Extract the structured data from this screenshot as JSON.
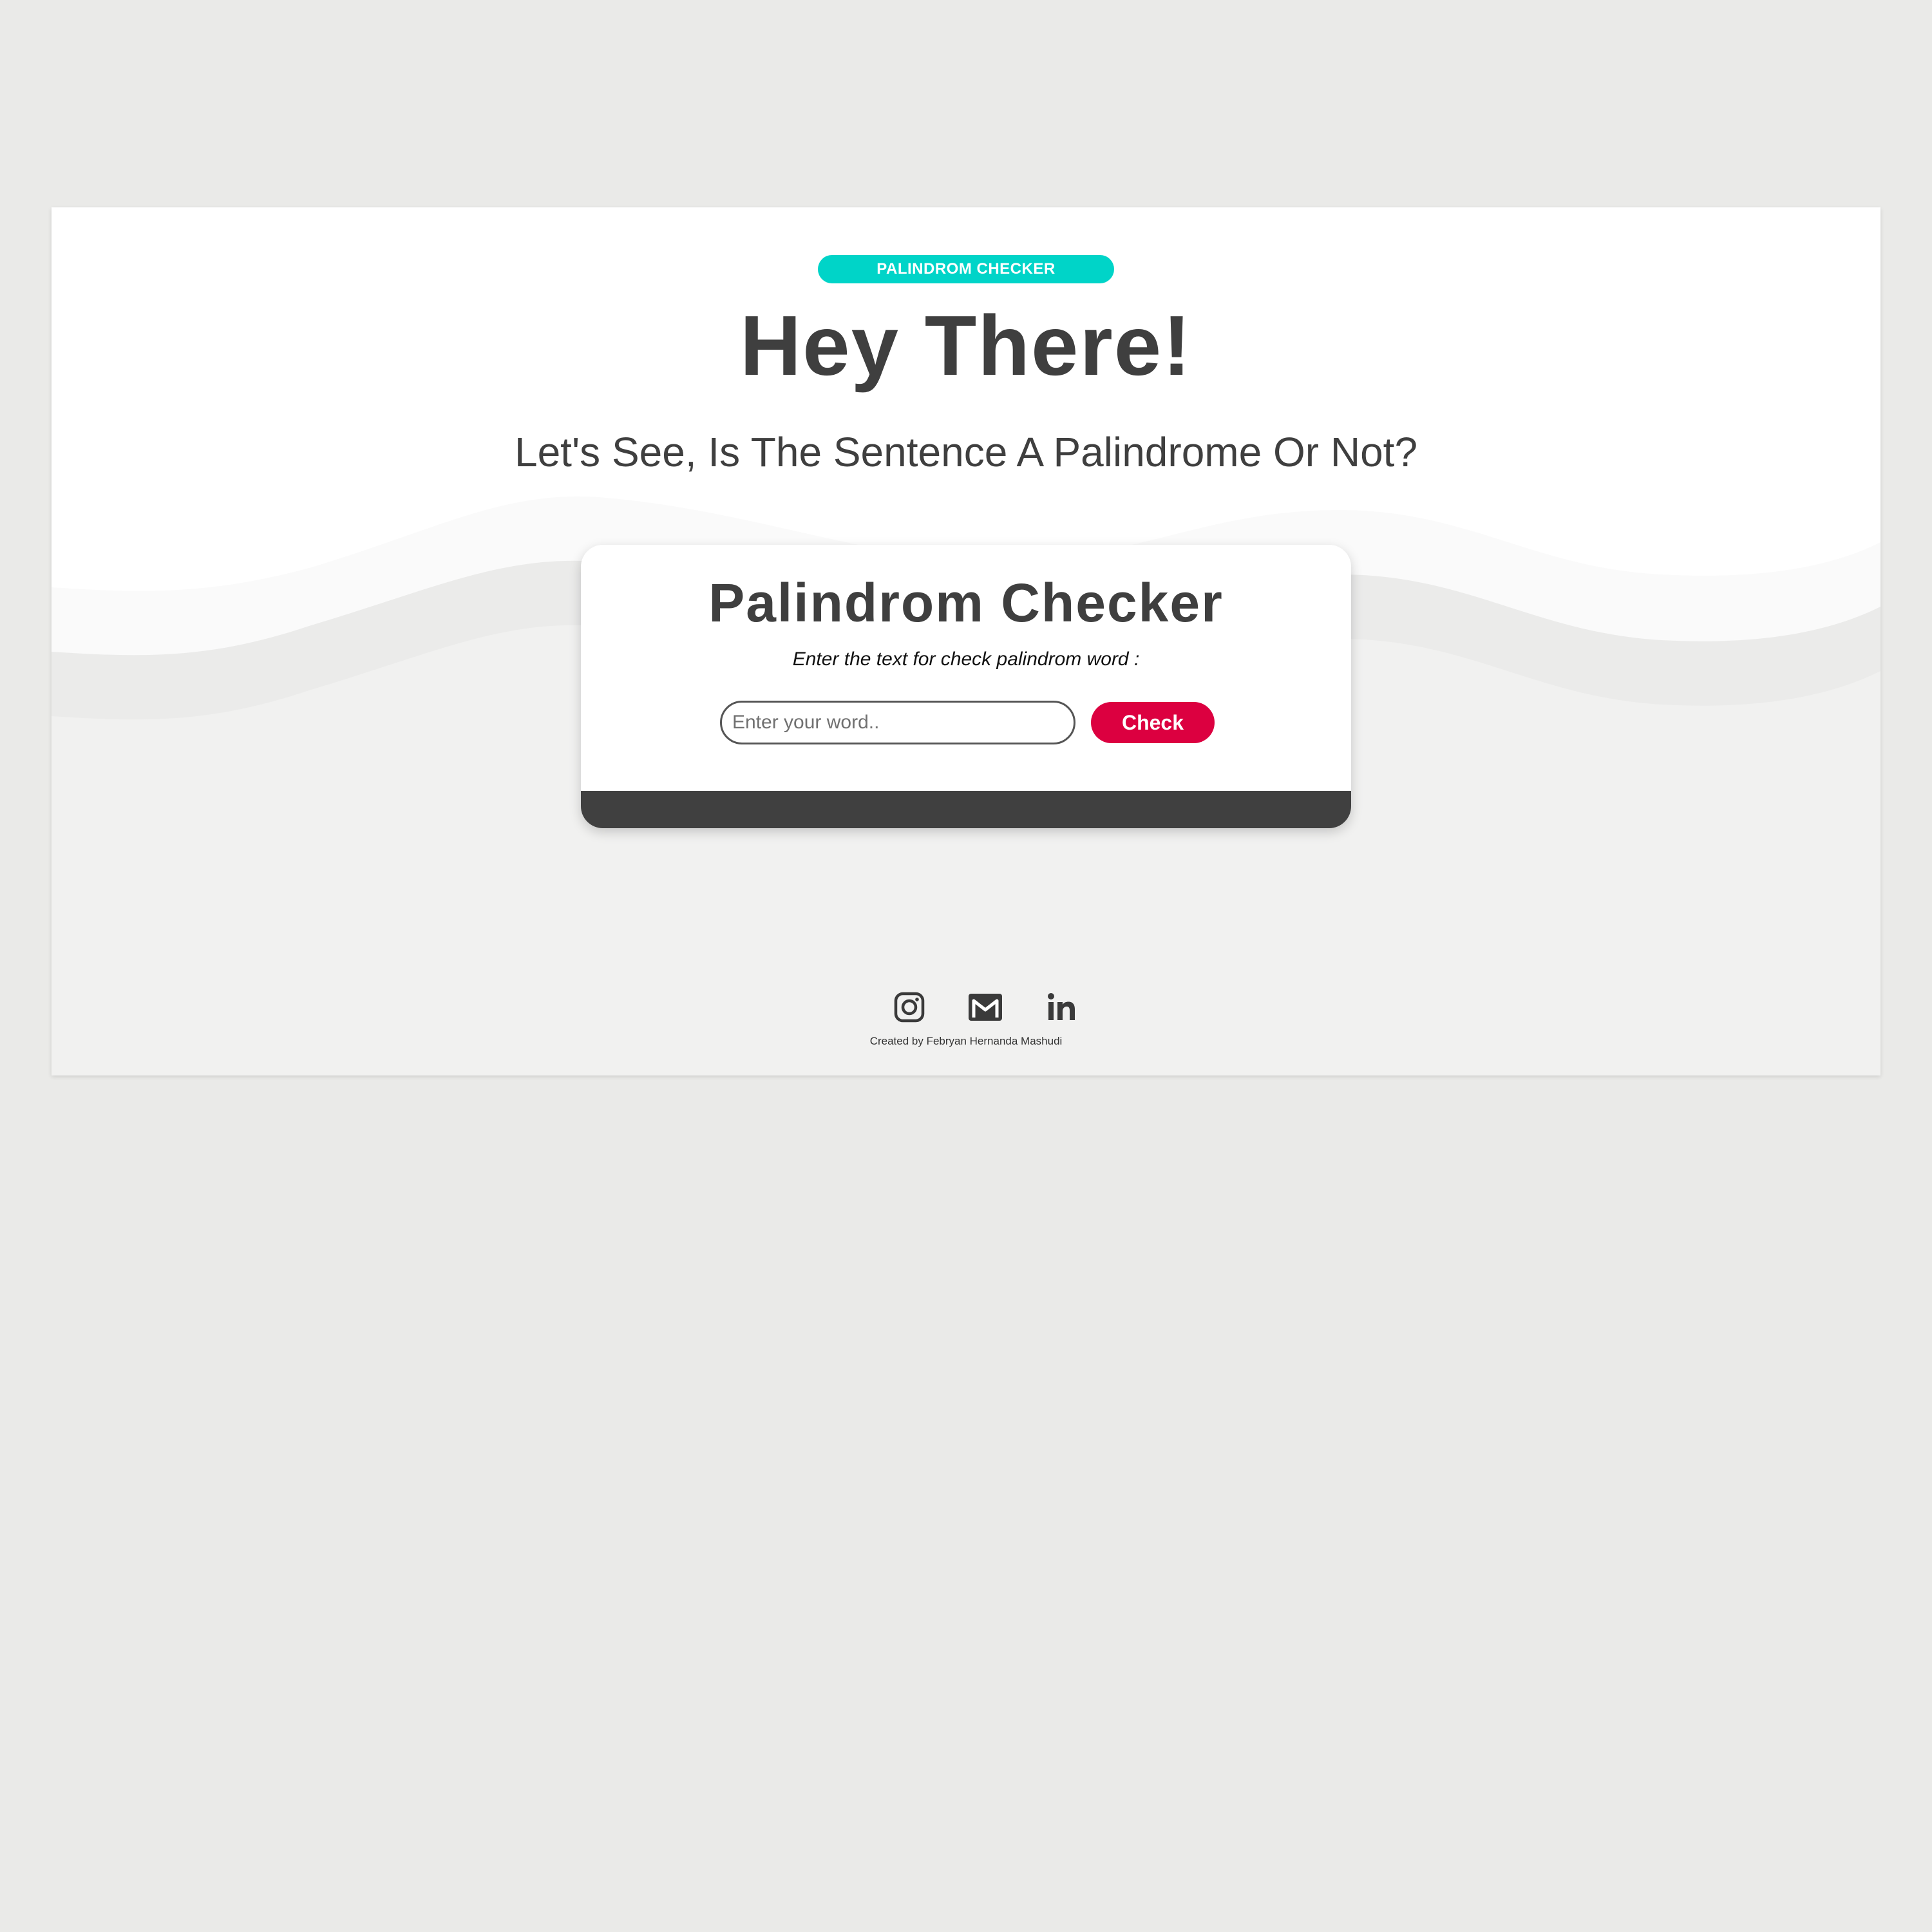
{
  "hero": {
    "badge": "PALINDROM CHECKER",
    "title": "Hey There!",
    "subtitle": "Let's See, Is The Sentence A Palindrome Or Not?"
  },
  "checker": {
    "title": "Palindrom Checker",
    "instructions": "Enter the text for check palindrom word :",
    "input_placeholder": "Enter your word..",
    "input_value": "",
    "button_label": "Check"
  },
  "footer": {
    "social_icons": [
      "instagram-icon",
      "mail-icon",
      "linkedin-icon"
    ],
    "credit": "Created by Febryan Hernanda Mashudi"
  },
  "colors": {
    "badge_bg": "#00d4c8",
    "button_bg": "#dc0040",
    "text_dark": "#3f3f3f",
    "card_footer": "#404040",
    "page_bg": "#eaeae8"
  }
}
